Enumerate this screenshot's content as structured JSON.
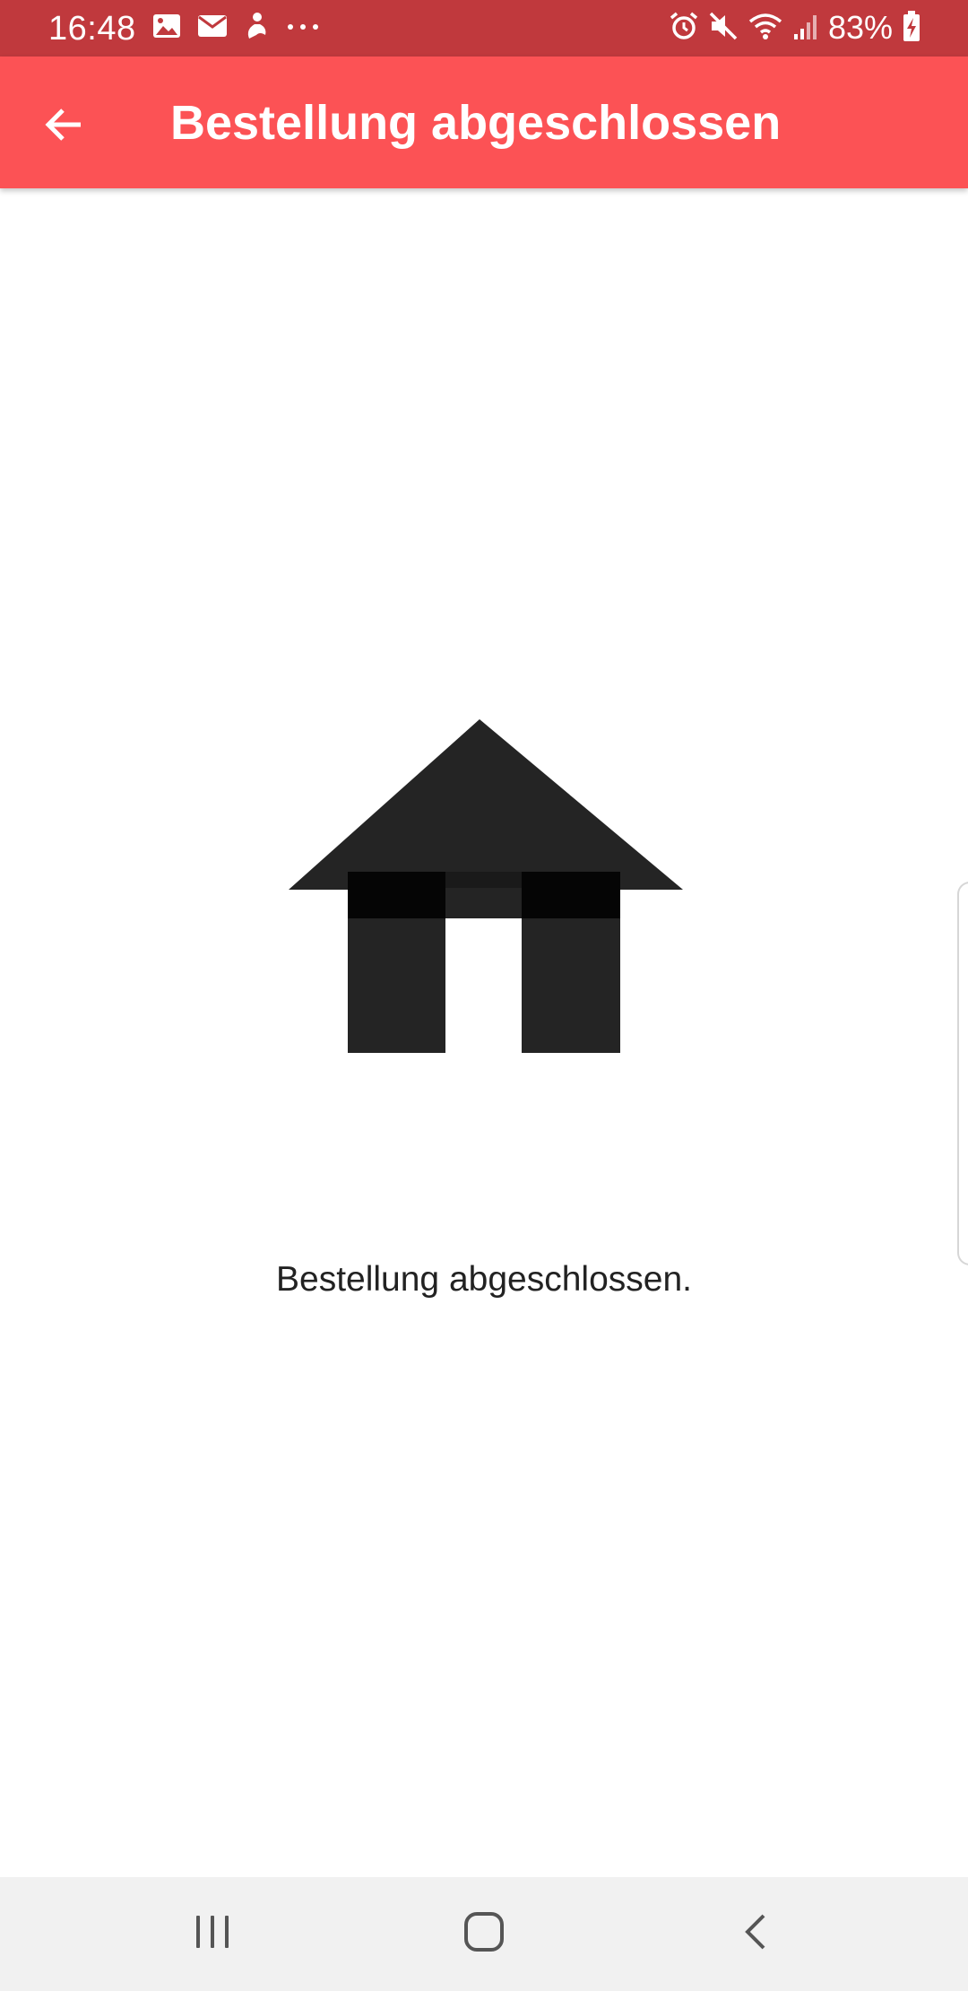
{
  "status_bar": {
    "time": "16:48",
    "notification_icons": [
      "image-icon",
      "email-icon",
      "app-notification-icon",
      "more-dots-icon"
    ],
    "system_icons": [
      "alarm-icon",
      "mute-icon",
      "wifi-icon",
      "signal-icon",
      "battery-charging-icon"
    ],
    "battery": "83%",
    "background_color": "#c0393d"
  },
  "app_bar": {
    "title": "Bestellung abgeschlossen",
    "back_icon": "arrow-back-icon",
    "background_color": "#fc5255"
  },
  "content": {
    "illustration": "house-icon",
    "message": "Bestellung abgeschlossen."
  },
  "nav_bar": {
    "buttons": [
      "recent-apps-icon",
      "home-icon",
      "back-icon"
    ]
  }
}
